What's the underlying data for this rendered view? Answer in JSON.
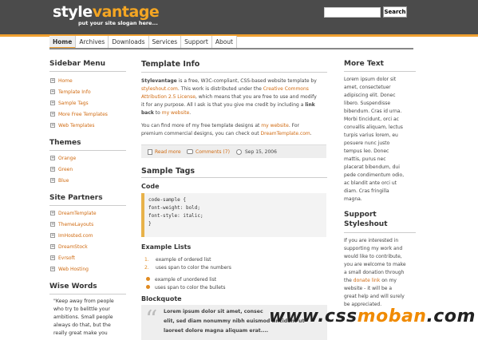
{
  "header": {
    "logo_part1": "style",
    "logo_part2": "vantage",
    "slogan": "put your site slogan here...",
    "search_placeholder": "",
    "search_button": "Search"
  },
  "nav": [
    "Home",
    "Archives",
    "Downloads",
    "Services",
    "Support",
    "About"
  ],
  "sidebar": {
    "menu_title": "Sidebar Menu",
    "menu": [
      "Home",
      "Template Info",
      "Sample Tags",
      "More Free Templates",
      "Web Templates"
    ],
    "themes_title": "Themes",
    "themes": [
      "Orange",
      "Green",
      "Blue"
    ],
    "partners_title": "Site Partners",
    "partners": [
      "DreamTemplate",
      "ThemeLayouts",
      "ImHosted.com",
      "DreamStock",
      "Evrsoft",
      "Web Hosting"
    ],
    "wise_title": "Wise Words",
    "wise_lines": [
      "\"Keep away from people",
      "who try to belittle your",
      "ambitions. Small people",
      "always do that, but the",
      "really great make you"
    ]
  },
  "main": {
    "title": "Template Info",
    "p1_lines": [
      [
        "Stylevantage",
        " is a free, W3C-compliant, CSS-based website template by"
      ],
      [
        "styleshout.com",
        ". This work is distributed under the ",
        "Creative Commons"
      ],
      [
        "Attribution 2.5 License",
        ", which means that you are free to use and modify"
      ],
      [
        "it for any purpose. All I ask is that you give me credit by including a ",
        "link"
      ],
      [
        "back",
        " to ",
        "my website",
        "."
      ]
    ],
    "p2_line1_a": "You can find more of my free template designs at ",
    "p2_line1_link": "my website",
    "p2_line1_b": ". For",
    "p2_line2_a": "premium commercial designs, you can check out ",
    "p2_line2_link": "DreamTemplate.com",
    "p2_line2_b": ".",
    "meta_read": "Read more",
    "meta_comments": "Comments (7)",
    "meta_date": "Sep 15, 2006",
    "sample_title": "Sample Tags",
    "code_title": "Code",
    "code_lines": [
      "code-sample {",
      "font-weight: bold;",
      "font-style: italic;",
      "}"
    ],
    "lists_title": "Example Lists",
    "ol": [
      "example of ordered list",
      "uses span to color the numbers"
    ],
    "ul": [
      "example of unordered list",
      "uses span to color the bullets"
    ],
    "bq_title": "Blockquote",
    "bq_lines": [
      "Lorem ipsum dolor sit amet, consec",
      "elit, sed diam nonummy nibh euismod tincidunt ut",
      "laoreet dolore magna aliquam erat...."
    ]
  },
  "right": {
    "more_title": "More Text",
    "more_lines": [
      "Lorem ipsum dolor sit",
      "amet, consectetuer",
      "adipiscing elit. Donec",
      "libero. Suspendisse",
      "bibendum. Cras id urna.",
      "Morbi tincidunt, orci ac",
      "convallis aliquam, lectus",
      "turpis varius lorem, eu",
      "posuere nunc justo",
      "tempus leo. Donec",
      "mattis, purus nec",
      "placerat bibendum, dui",
      "pede condimentum odio,",
      "ac blandit ante orci ut",
      "diam. Cras fringilla",
      "magna."
    ],
    "support_title1": "Support",
    "support_title2": "Styleshout",
    "support_lines": [
      "If you are interested in",
      "supporting my work and",
      "would like to contribute,",
      "you are welcome to make",
      "a small donation through",
      "the ",
      "donate link",
      " on my",
      "website - it will be a",
      "great help and will surely",
      "be appreciated."
    ]
  },
  "watermark": {
    "part1": "www.css",
    "part2": "moban",
    "part3": ".com"
  }
}
